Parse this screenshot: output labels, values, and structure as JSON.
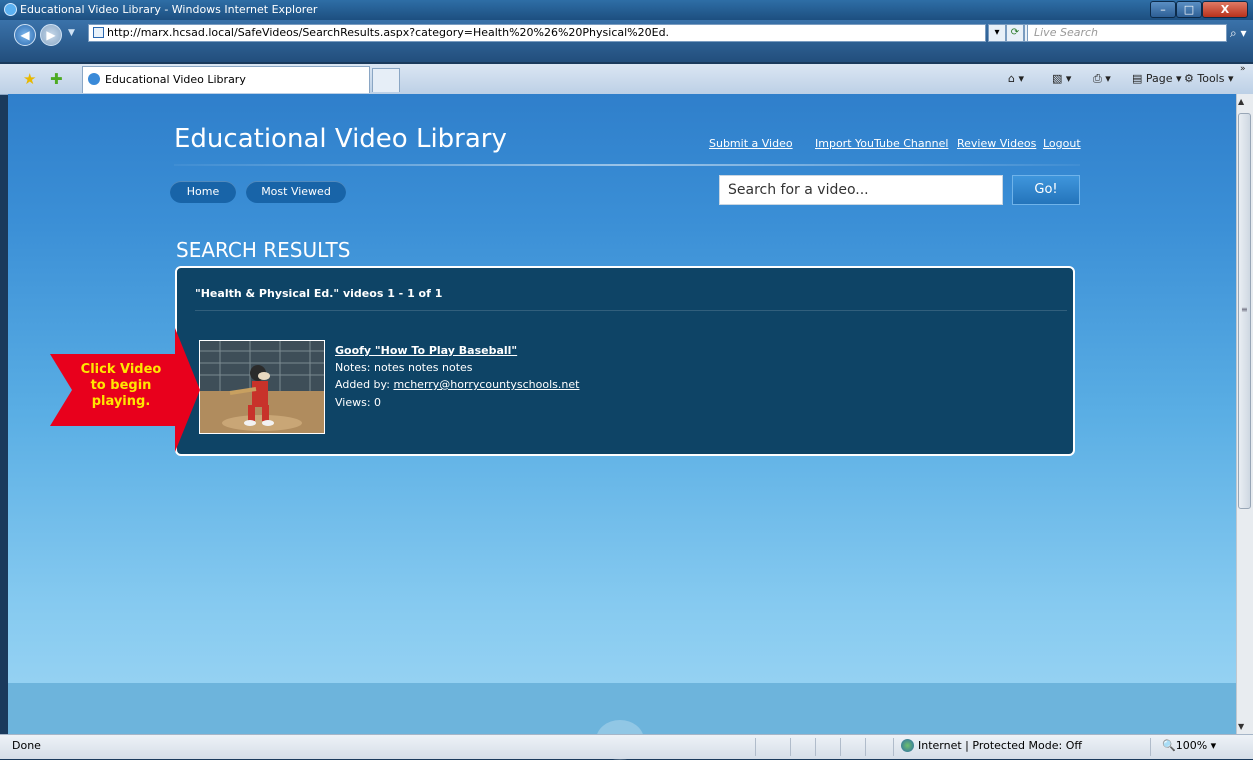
{
  "window": {
    "title": "Educational Video Library - Windows Internet Explorer",
    "min": "–",
    "max": "□",
    "close": "X"
  },
  "browser": {
    "url": "http://marx.hcsad.local/SafeVideos/SearchResults.aspx?category=Health%20%26%20Physical%20Ed.",
    "live_search_placeholder": "Live Search",
    "tab_title": "Educational Video Library",
    "toolbar": {
      "page": "Page ▾",
      "tools": "Tools ▾"
    }
  },
  "site": {
    "title": "Educational Video Library",
    "top_links": [
      "Submit a Video",
      "Import YouTube Channel",
      "Review Videos",
      "Logout"
    ],
    "nav": [
      "Home",
      "Most Viewed"
    ],
    "search_placeholder": "Search for a video...",
    "go_label": "Go!"
  },
  "results": {
    "section_title": "SEARCH RESULTS",
    "header": "\"Health & Physical Ed.\" videos 1 - 1 of 1",
    "items": [
      {
        "title": "Goofy \"How To Play Baseball\"",
        "notes": "Notes: notes notes notes",
        "added_by_label": "Added by: ",
        "added_by_email": "mcherry@horrycountyschools.net",
        "views": "Views: 0"
      }
    ]
  },
  "callout": {
    "line1": "Click Video",
    "line2": "to begin",
    "line3": "playing."
  },
  "status": {
    "left": "Done",
    "zone": "Internet | Protected Mode: Off",
    "zoom": "100%"
  },
  "colors": {
    "accent": "#1864a8",
    "panel": "#0e4466",
    "callout_red": "#e8001c",
    "callout_text": "#ffe600"
  }
}
